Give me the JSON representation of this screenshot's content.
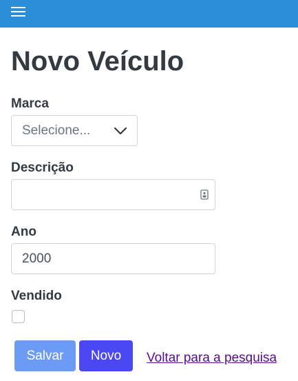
{
  "header": {
    "menu_icon": "hamburger-menu-icon",
    "bar_color": "#2b8fd8"
  },
  "page": {
    "title": "Novo Veículo"
  },
  "form": {
    "marca_label": "Marca",
    "marca_selected": "Selecione...",
    "descricao_label": "Descrição",
    "descricao_value": "",
    "ano_label": "Ano",
    "ano_value": "2000",
    "vendido_label": "Vendido",
    "vendido_checked": false
  },
  "actions": {
    "salvar_label": "Salvar",
    "novo_label": "Novo",
    "voltar_link": "Voltar para a pesquisa"
  },
  "colors": {
    "salvar": "#6b9bf4",
    "novo": "#4a48f3",
    "link": "#5a0a8c"
  }
}
